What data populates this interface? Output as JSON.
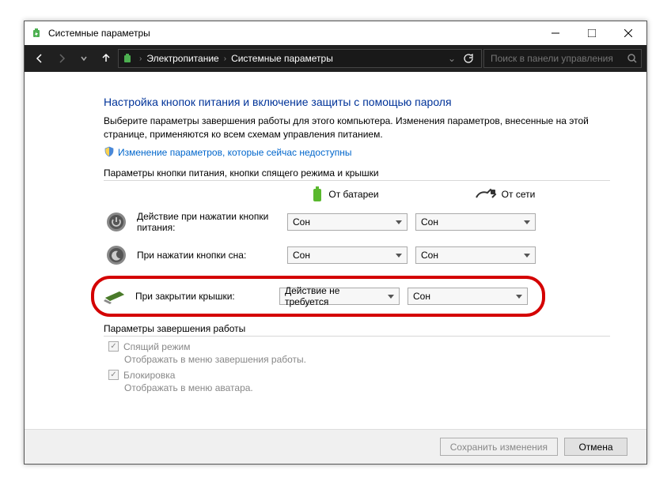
{
  "window": {
    "title": "Системные параметры"
  },
  "nav": {
    "breadcrumb1": "Электропитание",
    "breadcrumb2": "Системные параметры",
    "search_placeholder": "Поиск в панели управления"
  },
  "page": {
    "heading": "Настройка кнопок питания и включение защиты с помощью пароля",
    "desc": "Выберите параметры завершения работы для этого компьютера. Изменения параметров, внесенные на этой странице, применяются ко всем схемам управления питанием.",
    "change_link": "Изменение параметров, которые сейчас недоступны"
  },
  "section1": {
    "title": "Параметры кнопки питания, кнопки спящего режима и крышки",
    "col_battery": "От батареи",
    "col_ac": "От сети",
    "rows": {
      "power": {
        "label": "Действие при нажатии кнопки питания:",
        "battery": "Сон",
        "ac": "Сон"
      },
      "sleep": {
        "label": "При нажатии кнопки сна:",
        "battery": "Сон",
        "ac": "Сон"
      },
      "lid": {
        "label": "При закрытии крышки:",
        "battery": "Действие не требуется",
        "ac": "Сон"
      }
    }
  },
  "section2": {
    "title": "Параметры завершения работы",
    "sleep_mode": "Спящий режим",
    "sleep_sub": "Отображать в меню завершения работы.",
    "lock": "Блокировка",
    "lock_sub": "Отображать в меню аватара."
  },
  "footer": {
    "save": "Сохранить изменения",
    "cancel": "Отмена"
  }
}
